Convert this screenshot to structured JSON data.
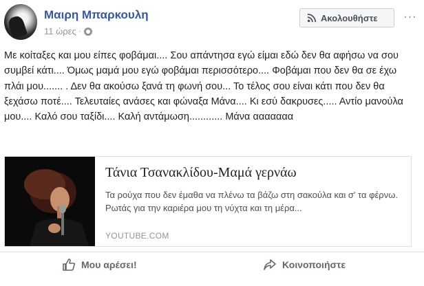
{
  "post": {
    "author": "Μαιρη Μπαρκουλη",
    "time": "11 ώρες",
    "privacy_icon": "globe-icon",
    "follow_label": "Ακολουθήστε",
    "more_label": "···",
    "text": "Με κοίταξες και μου είπες φοβάμαι.... Σου απάντησα εγώ είμαι εδώ δεν θα αφήσω να σου συμβεί κάτι.... Όμως μαμά μου εγώ φοβάμαι περισσότερο.... Φοβάμαι που δεν θα σε έχω πλάι μου....... . Δεν θα ακούσω ξανά τη φωνή σου... Το τέλος σου είναι κάτι που δεν θα ξεχάσω ποτέ.... Τελευταίες ανάσες και φώναξα Μάνα.... Κι εσύ δακρυσες..... Αντίο μανούλα μου.... Καλό σου ταξίδι.... Καλή αντάμωση............ Μάνα ααααααα"
  },
  "link_preview": {
    "title": "Τάνια Τσανακλίδου-Μαμά γερνάω",
    "description": "Τα ρούχα που δεν έμαθα να πλένω τα βάζω στη σακούλα και σ' τα φέρνω. Ρωτάς για την καριέρα μου τη νύχτα και τη μέρα...",
    "domain": "YOUTUBE.COM"
  },
  "actions": {
    "like_label": "Μου αρέσει!",
    "share_label": "Κοινοποιήστε"
  },
  "colors": {
    "author_link": "#385898",
    "secondary_text": "#90949c",
    "action_text": "#606770",
    "border": "#dddfe2"
  }
}
